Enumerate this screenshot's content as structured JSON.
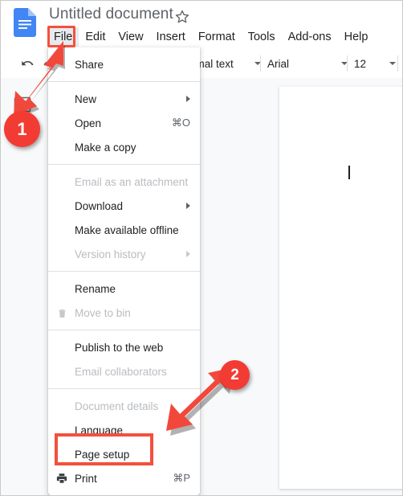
{
  "window": {
    "app": "Google Docs",
    "document_title": "Untitled document"
  },
  "titlebar": {
    "doc_icon": "google-docs-icon",
    "star_icon": "star-outline-icon",
    "title": "Untitled document"
  },
  "menubar": {
    "items": [
      {
        "label": "File",
        "active": true
      },
      {
        "label": "Edit",
        "active": false
      },
      {
        "label": "View",
        "active": false
      },
      {
        "label": "Insert",
        "active": false
      },
      {
        "label": "Format",
        "active": false
      },
      {
        "label": "Tools",
        "active": false
      },
      {
        "label": "Add-ons",
        "active": false
      },
      {
        "label": "Help",
        "active": false
      }
    ]
  },
  "toolbar": {
    "undo_icon": "undo-icon",
    "redo_icon": "redo-icon",
    "paragraph_style": "rmal text",
    "font_family": "Arial",
    "font_size": "12"
  },
  "left_rail": {
    "outline_icon": "document-outline-icon"
  },
  "file_menu": {
    "groups": [
      {
        "items": [
          {
            "label": "Share",
            "accel": "",
            "submenu": false,
            "disabled": false,
            "icon": ""
          }
        ]
      },
      {
        "items": [
          {
            "label": "New",
            "accel": "",
            "submenu": true,
            "disabled": false,
            "icon": ""
          },
          {
            "label": "Open",
            "accel": "⌘O",
            "submenu": false,
            "disabled": false,
            "icon": ""
          },
          {
            "label": "Make a copy",
            "accel": "",
            "submenu": false,
            "disabled": false,
            "icon": ""
          }
        ]
      },
      {
        "items": [
          {
            "label": "Email as an attachment",
            "accel": "",
            "submenu": false,
            "disabled": true,
            "icon": ""
          },
          {
            "label": "Download",
            "accel": "",
            "submenu": true,
            "disabled": false,
            "icon": ""
          },
          {
            "label": "Make available offline",
            "accel": "",
            "submenu": false,
            "disabled": false,
            "icon": ""
          },
          {
            "label": "Version history",
            "accel": "",
            "submenu": true,
            "disabled": true,
            "icon": ""
          }
        ]
      },
      {
        "items": [
          {
            "label": "Rename",
            "accel": "",
            "submenu": false,
            "disabled": false,
            "icon": ""
          },
          {
            "label": "Move to bin",
            "accel": "",
            "submenu": false,
            "disabled": true,
            "icon": "trash-icon"
          }
        ]
      },
      {
        "items": [
          {
            "label": "Publish to the web",
            "accel": "",
            "submenu": false,
            "disabled": false,
            "icon": ""
          },
          {
            "label": "Email collaborators",
            "accel": "",
            "submenu": false,
            "disabled": true,
            "icon": ""
          }
        ]
      },
      {
        "items": [
          {
            "label": "Document details",
            "accel": "",
            "submenu": false,
            "disabled": true,
            "icon": ""
          },
          {
            "label": "Language",
            "accel": "",
            "submenu": false,
            "disabled": false,
            "icon": ""
          },
          {
            "label": "Page setup",
            "accel": "",
            "submenu": false,
            "disabled": false,
            "icon": ""
          },
          {
            "label": "Print",
            "accel": "⌘P",
            "submenu": false,
            "disabled": false,
            "icon": "printer-icon"
          }
        ]
      }
    ]
  },
  "annotations": {
    "highlight_color": "#f4503c",
    "badge_color": "#f23b33",
    "markers": [
      {
        "number": "1",
        "target": "File menu button"
      },
      {
        "number": "2",
        "target": "Page setup menu item"
      }
    ]
  }
}
